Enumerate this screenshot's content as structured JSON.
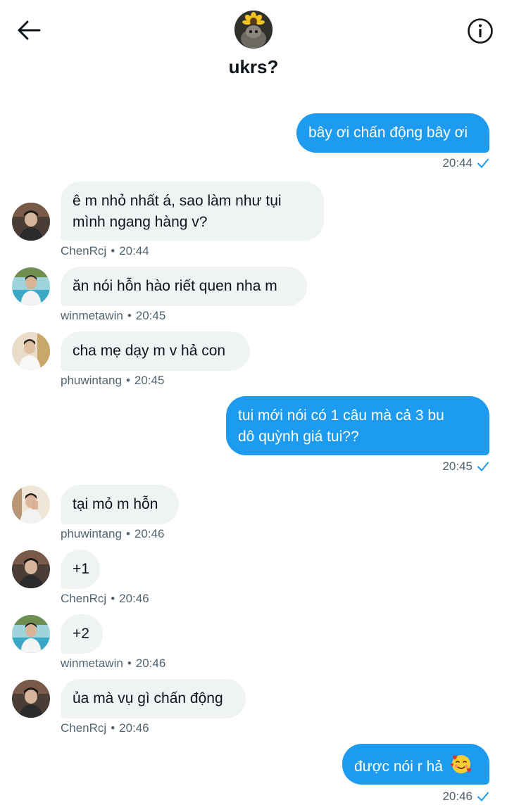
{
  "header": {
    "title": "ukrs?",
    "back_icon": "arrow-left-icon",
    "info_icon": "info-circle-icon"
  },
  "colors": {
    "accent": "#1d9bf0",
    "incoming_bubble": "#eff3f4",
    "meta_text": "#536471"
  },
  "messages": [
    {
      "direction": "out",
      "text": "bây ơi chấn động bây ơi",
      "time": "20:44"
    },
    {
      "direction": "in",
      "line1": "ê m nhỏ nhất á, sao làm như tụi",
      "line2": "mình ngang hàng v?",
      "sender": "ChenRcj",
      "time": "20:44"
    },
    {
      "direction": "in",
      "text": "ăn nói hỗn hào riết quen nha m",
      "sender": "winmetawin",
      "time": "20:45"
    },
    {
      "direction": "in",
      "text": "cha mẹ dạy m v hả con",
      "sender": "phuwintang",
      "time": "20:45"
    },
    {
      "direction": "out",
      "line1": "tui mới nói có 1 câu mà cả 3 bu",
      "line2": "dô quỳnh giá tui??",
      "time": "20:45"
    },
    {
      "direction": "in",
      "text": "tại mỏ m hỗn",
      "sender": "phuwintang",
      "time": "20:46"
    },
    {
      "direction": "in",
      "text": "+1",
      "sender": "ChenRcj",
      "time": "20:46"
    },
    {
      "direction": "in",
      "text": "+2",
      "sender": "winmetawin",
      "time": "20:46"
    },
    {
      "direction": "in",
      "text": "ủa mà vụ gì chấn động",
      "sender": "ChenRcj",
      "time": "20:46"
    },
    {
      "direction": "out",
      "text": "được nói r hả",
      "emoji": "smiling-face-with-hearts",
      "time": "20:46"
    }
  ],
  "separator": "•"
}
